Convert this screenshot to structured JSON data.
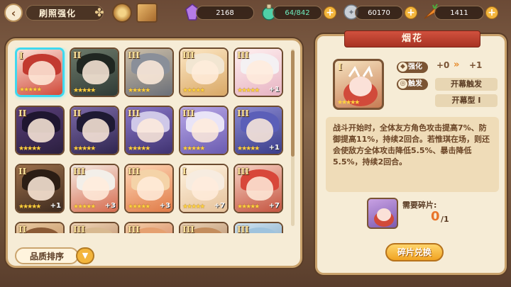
{
  "header": {
    "title": "刷照强化",
    "resources": [
      {
        "icon": "crystal-icon",
        "value": "2168",
        "color": "#b57be6"
      },
      {
        "icon": "stamina-potion-icon",
        "value": "64/842",
        "color": "#4fd1a8"
      },
      {
        "icon": "silver-coin-icon",
        "value": "60170",
        "color": "#c9cfd6"
      },
      {
        "icon": "carrot-icon",
        "value": "1411",
        "color": "#f08a2a"
      }
    ]
  },
  "grid": {
    "cards": [
      {
        "tier": "I",
        "stars": "★★★★★",
        "bonus": "",
        "selected": true,
        "c1": "#fbe1d8",
        "c2": "#d14a3a",
        "hair": "#c23a30"
      },
      {
        "tier": "II",
        "stars": "★★★★★",
        "bonus": "",
        "c1": "#6d7a6a",
        "c2": "#2f3a35",
        "hair": "#202621"
      },
      {
        "tier": "III",
        "stars": "★★★★★",
        "bonus": "",
        "c1": "#cdbfa8",
        "c2": "#6b6f78",
        "hair": "#8a8f99"
      },
      {
        "tier": "III",
        "stars": "★★★★★",
        "bonus": "",
        "c1": "#fde7c4",
        "c2": "#d9a866",
        "hair": "#f2e6d2"
      },
      {
        "tier": "III",
        "stars": "★★★★★",
        "bonus": "+1",
        "c1": "#fff0f0",
        "c2": "#e7b3c2",
        "hair": "#f4f1f3"
      },
      {
        "tier": "II",
        "stars": "★★★★★",
        "bonus": "",
        "c1": "#5a3f7a",
        "c2": "#2b1f3f",
        "hair": "#1f1630"
      },
      {
        "tier": "II",
        "stars": "★★★★★",
        "bonus": "",
        "c1": "#7c6aa8",
        "c2": "#2f254f",
        "hair": "#1e1a33"
      },
      {
        "tier": "III",
        "stars": "★★★★★",
        "bonus": "",
        "c1": "#8a78c9",
        "c2": "#3f3270",
        "hair": "#cfc8e8"
      },
      {
        "tier": "III",
        "stars": "★★★★★",
        "bonus": "",
        "c1": "#b9a8e8",
        "c2": "#6a5bb0",
        "hair": "#e9e4f7"
      },
      {
        "tier": "III",
        "stars": "★★★★★",
        "bonus": "+1",
        "c1": "#8b8ad2",
        "c2": "#3a3d8a",
        "hair": "#5b5fb8"
      },
      {
        "tier": "II",
        "stars": "★★★★★",
        "bonus": "+1",
        "c1": "#9b6f4a",
        "c2": "#3d2a1e",
        "hair": "#2b1d14"
      },
      {
        "tier": "III",
        "stars": "★★★★★",
        "bonus": "+3",
        "c1": "#f6eee6",
        "c2": "#d66a4d",
        "hair": "#f3efe9"
      },
      {
        "tier": "III",
        "stars": "★★★★★",
        "bonus": "+3",
        "c1": "#ffd8b8",
        "c2": "#e07a46",
        "hair": "#f4d3a8"
      },
      {
        "tier": "I",
        "stars": "★★★★★",
        "bonus": "+7",
        "c1": "#fff3e0",
        "c2": "#e6c29a",
        "hair": "#f7ece0"
      },
      {
        "tier": "III",
        "stars": "★★★★★",
        "bonus": "+7",
        "c1": "#f7d2c4",
        "c2": "#c4533f",
        "hair": "#d8473a"
      },
      {
        "tier": "II",
        "stars": "",
        "bonus": "",
        "c1": "#e9c9a0",
        "c2": "#b07a4a",
        "hair": "#8a5a35"
      },
      {
        "tier": "III",
        "stars": "",
        "bonus": "",
        "c1": "#f1d6b8",
        "c2": "#a06a42",
        "hair": "#d8b990"
      },
      {
        "tier": "III",
        "stars": "",
        "bonus": "",
        "c1": "#f4cfa8",
        "c2": "#c45a3a",
        "hair": "#e5a070"
      },
      {
        "tier": "III",
        "stars": "",
        "bonus": "",
        "c1": "#ead2b5",
        "c2": "#9c6b45",
        "hair": "#c38d5d"
      },
      {
        "tier": "III",
        "stars": "",
        "bonus": "",
        "c1": "#cfe3f0",
        "c2": "#5f8fb5",
        "hair": "#9fc3dd"
      }
    ]
  },
  "sort": {
    "label": "品质排序"
  },
  "detail": {
    "name": "烟花",
    "card_tier": "I",
    "card_stars": "★★★★★",
    "enhance_label": "强化",
    "enhance_from": "+0",
    "enhance_to": "+1",
    "trigger_label": "触发",
    "trigger_value": "开幕触发",
    "trigger_type": "开幕型 I",
    "description": "战斗开始时，全体友方角色攻击提高7%、防御提高11%，持续2回合。若惟琪在场，则还会使敌方全体攻击降低5.5%、暴击降低5.5%，持续2回合。",
    "fragments_label": "需要碎片:",
    "fragments_have": "0",
    "fragments_need": "/1",
    "exchange_label": "碎片兑换"
  }
}
